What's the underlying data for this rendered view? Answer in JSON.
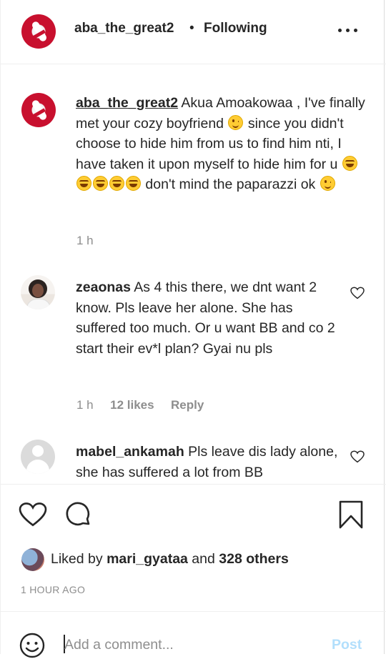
{
  "header": {
    "username": "aba_the_great2",
    "separator": "•",
    "follow_status": "Following"
  },
  "caption": {
    "username": "aba_the_great2",
    "text_1": " Akua Amoakowaa , I've finally met your cozy boyfriend ",
    "text_2": " since you didn't choose to hide him from us to find him nti, I have taken it upon myself to hide him for u ",
    "text_3": " don't mind the paparazzi ok ",
    "time": "1 h"
  },
  "comments": [
    {
      "username": "zeaonas",
      "text": " As 4 this there, we dnt want 2 know. Pls leave her alone. She has suffered too much. Or u want BB and co 2 start their ev*l plan? Gyai nu pls",
      "time": "1 h",
      "likes": "12 likes",
      "reply": "Reply"
    },
    {
      "username": "mabel_ankamah",
      "text": " Pls leave dis lady alone, she has suffered a lot from BB"
    }
  ],
  "likes": {
    "prefix": "Liked by ",
    "user": "mari_gyataa",
    "middle": " and ",
    "others": "328 others"
  },
  "time_ago": "1 HOUR AGO",
  "add_comment": {
    "placeholder": "Add a comment...",
    "post_label": "Post"
  },
  "colors": {
    "text": "#262626",
    "secondary": "#8e8e8e",
    "post_disabled": "#b2dffc",
    "avatar_red": "#c8102e"
  }
}
